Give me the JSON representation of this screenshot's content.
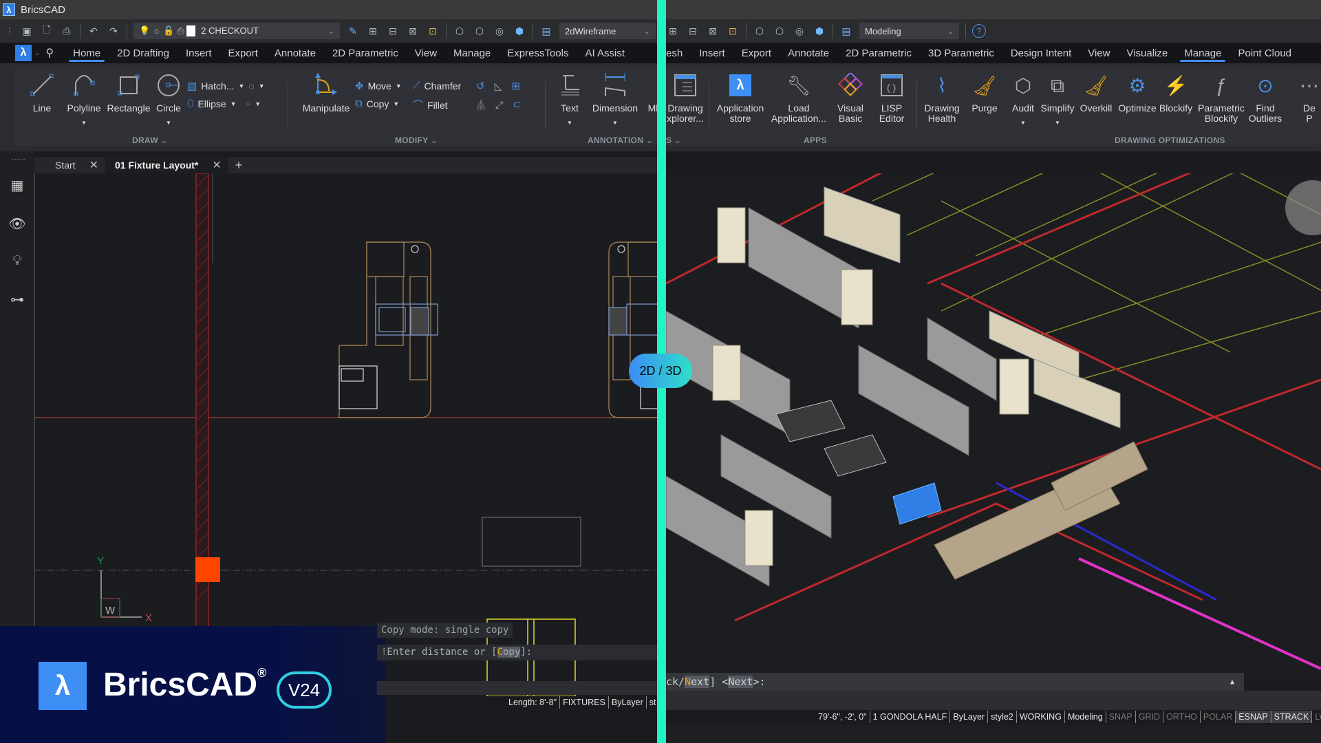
{
  "app": {
    "title": "BricsCAD"
  },
  "quick_access_left": {
    "icons": [
      "save-icon",
      "print-preview-icon",
      "plot-icon",
      "undo-icon",
      "redo-icon"
    ],
    "layer_combo": {
      "value": "2 CHECKOUT",
      "layer_color": "#ffffff"
    },
    "visual_style_combo": {
      "value": "2dWireframe"
    }
  },
  "quick_access_right": {
    "workspace_combo": {
      "value": "Modeling"
    },
    "help_icon": "?"
  },
  "ribbon_tabs_left": [
    {
      "label": "Home",
      "active": true
    },
    {
      "label": "2D Drafting"
    },
    {
      "label": "Insert"
    },
    {
      "label": "Export"
    },
    {
      "label": "Annotate"
    },
    {
      "label": "2D Parametric"
    },
    {
      "label": "View"
    },
    {
      "label": "Manage"
    },
    {
      "label": "ExpressTools"
    },
    {
      "label": "AI Assist"
    }
  ],
  "ribbon_tabs_right": [
    {
      "label": "esh"
    },
    {
      "label": "Insert"
    },
    {
      "label": "Export"
    },
    {
      "label": "Annotate"
    },
    {
      "label": "2D Parametric"
    },
    {
      "label": "3D Parametric"
    },
    {
      "label": "Design Intent"
    },
    {
      "label": "View"
    },
    {
      "label": "Visualize"
    },
    {
      "label": "Manage",
      "active": true
    },
    {
      "label": "Point Cloud"
    }
  ],
  "ribbon_left": {
    "draw": {
      "label": "DRAW",
      "tools": [
        "Line",
        "Polyline",
        "Rectangle",
        "Circle"
      ],
      "small": [
        "Hatch...",
        "Ellipse"
      ]
    },
    "modify": {
      "label": "MODIFY",
      "manipulate": "Manipulate",
      "small": [
        "Move",
        "Copy",
        "Chamfer",
        "Fillet"
      ]
    },
    "annotation": {
      "label": "ANNOTATION",
      "tools": [
        "Text",
        "Dimension",
        "Ml"
      ]
    }
  },
  "ribbon_right": {
    "apps": {
      "label": "APPS",
      "tools": [
        {
          "label": "Drawing\nxplorer...",
          "l1": "Drawing",
          "l2": "xplorer..."
        },
        {
          "l1": "Application",
          "l2": "store"
        },
        {
          "l1": "Load",
          "l2": "Application..."
        },
        {
          "l1": "Visual",
          "l2": "Basic"
        },
        {
          "l1": "LISP",
          "l2": "Editor"
        }
      ],
      "prev_group_label": "S"
    },
    "opt": {
      "label": "DRAWING OPTIMIZATIONS",
      "tools": [
        {
          "l1": "Drawing",
          "l2": "Health"
        },
        {
          "l1": "Purge",
          "l2": ""
        },
        {
          "l1": "Audit",
          "l2": ""
        },
        {
          "l1": "Simplify",
          "l2": ""
        },
        {
          "l1": "Overkill",
          "l2": ""
        },
        {
          "l1": "Optimize",
          "l2": ""
        },
        {
          "l1": "Blockify",
          "l2": ""
        },
        {
          "l1": "Parametric",
          "l2": "Blockify"
        },
        {
          "l1": "Find",
          "l2": "Outliers"
        },
        {
          "l1": "De",
          "l2": "P"
        }
      ]
    }
  },
  "doc_tabs": [
    {
      "label": "Start"
    },
    {
      "label": "01 Fixture Layout*",
      "active": true
    }
  ],
  "ucs": {
    "x": "X",
    "y": "Y",
    "w": "W"
  },
  "switch_pill": "2D / 3D",
  "command_left": {
    "history": "Copy mode: single copy",
    "prompt_prefix": "Enter distance or [",
    "option_first": "C",
    "option_rest": "opy",
    "prompt_suffix": "]:"
  },
  "command_right": {
    "prefix": "ck/",
    "opt_first": "N",
    "opt_rest": "ext",
    "mid": "] <",
    "default": "Next",
    "suffix": ">:"
  },
  "status_left": [
    "Length: 8'-8\"",
    "FIXTURES",
    "ByLayer",
    "st"
  ],
  "status_right": [
    {
      "label": "79'-6\", -2', 0\""
    },
    {
      "label": "1 GONDOLA HALF"
    },
    {
      "label": "ByLayer"
    },
    {
      "label": "style2"
    },
    {
      "label": "WORKING"
    },
    {
      "label": "Modeling"
    },
    {
      "label": "SNAP",
      "state": "off"
    },
    {
      "label": "GRID",
      "state": "off"
    },
    {
      "label": "ORTHO",
      "state": "off"
    },
    {
      "label": "POLAR",
      "state": "off"
    },
    {
      "label": "ESNAP",
      "state": "on"
    },
    {
      "label": "STRACK",
      "state": "on"
    },
    {
      "label": "LWT",
      "state": "off"
    }
  ],
  "brand": {
    "name": "BricsCAD",
    "reg": "®",
    "version": "V24"
  },
  "colors": {
    "accent": "#3f8ef0",
    "divider": "#1ff5c4",
    "brand_bg": "#061046",
    "brand_logo": "#3d8ff5",
    "fixture_line": "#b08a5a",
    "wall_red": "#c0282c"
  }
}
